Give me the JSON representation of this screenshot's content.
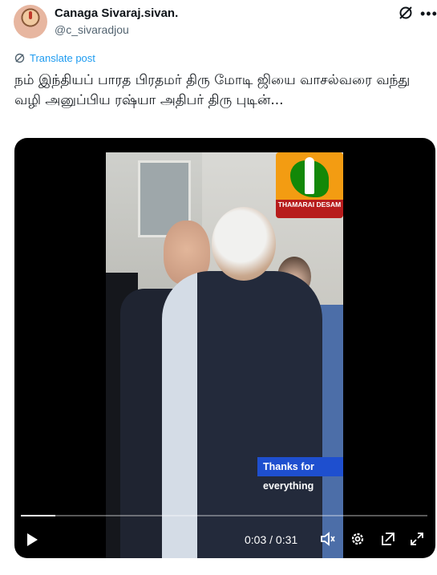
{
  "author": {
    "name": "Canaga Sivaraj.sivan.",
    "handle": "@c_sivaradjou",
    "avatar_icon": "avatar-portrait"
  },
  "header_icons": {
    "grok": "grok-icon",
    "more": "more-icon"
  },
  "translate": {
    "label": "Translate post",
    "icon": "translate-icon"
  },
  "post": {
    "text": "நம் இந்தியப் பாரத பிரதமர் திரு மோடி ஜியை வாசல்வரை வந்து வழி அனுப்பிய ரஷ்யா அதிபர் திரு புடின்..."
  },
  "video": {
    "logo_text": "THAMARAI DESAM",
    "caption": "Thanks for everything",
    "current_time": "0:03",
    "separator": "/",
    "duration": "0:31",
    "progress": 0.085,
    "controls": [
      "play-icon",
      "volume-icon",
      "settings-icon",
      "popout-icon",
      "fullscreen-icon"
    ]
  },
  "colors": {
    "link": "#1d9bf0",
    "text": "#0f1419",
    "muted": "#536471",
    "caption_bg": "#1e4fcf",
    "logo_banner": "#b71c1c"
  }
}
